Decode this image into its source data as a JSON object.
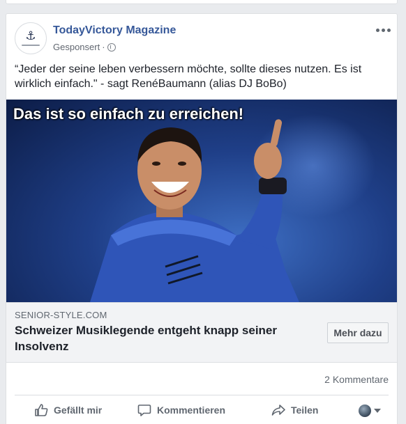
{
  "post": {
    "page_name": "TodayVictory Magazine",
    "sponsored_label": "Gesponsert",
    "separator": "·",
    "text": "“Jeder der seine leben verbessern möchte, sollte dieses nutzen. Es ist wirklich einfach.\" - sagt RenéBaumann (alias DJ BoBo)",
    "image_caption": "Das ist so einfach zu erreichen!"
  },
  "link_preview": {
    "domain": "SENIOR-STYLE.COM",
    "title": "Schweizer Musiklegende entgeht knapp seiner Insolvenz",
    "cta_label": "Mehr dazu"
  },
  "stats": {
    "comments": "2 Kommentare"
  },
  "actions": {
    "like": "Gefällt mir",
    "comment": "Kommentieren",
    "share": "Teilen"
  },
  "icons": {
    "avatar": "anchor-logo-icon",
    "privacy": "globe-icon",
    "more": "more-options-icon",
    "like": "thumbs-up-icon",
    "comment": "comment-bubble-icon",
    "share": "share-arrow-icon"
  },
  "colors": {
    "brand_link": "#365899",
    "text": "#1d2129",
    "secondary": "#606770",
    "page_bg": "#e9ebee"
  }
}
